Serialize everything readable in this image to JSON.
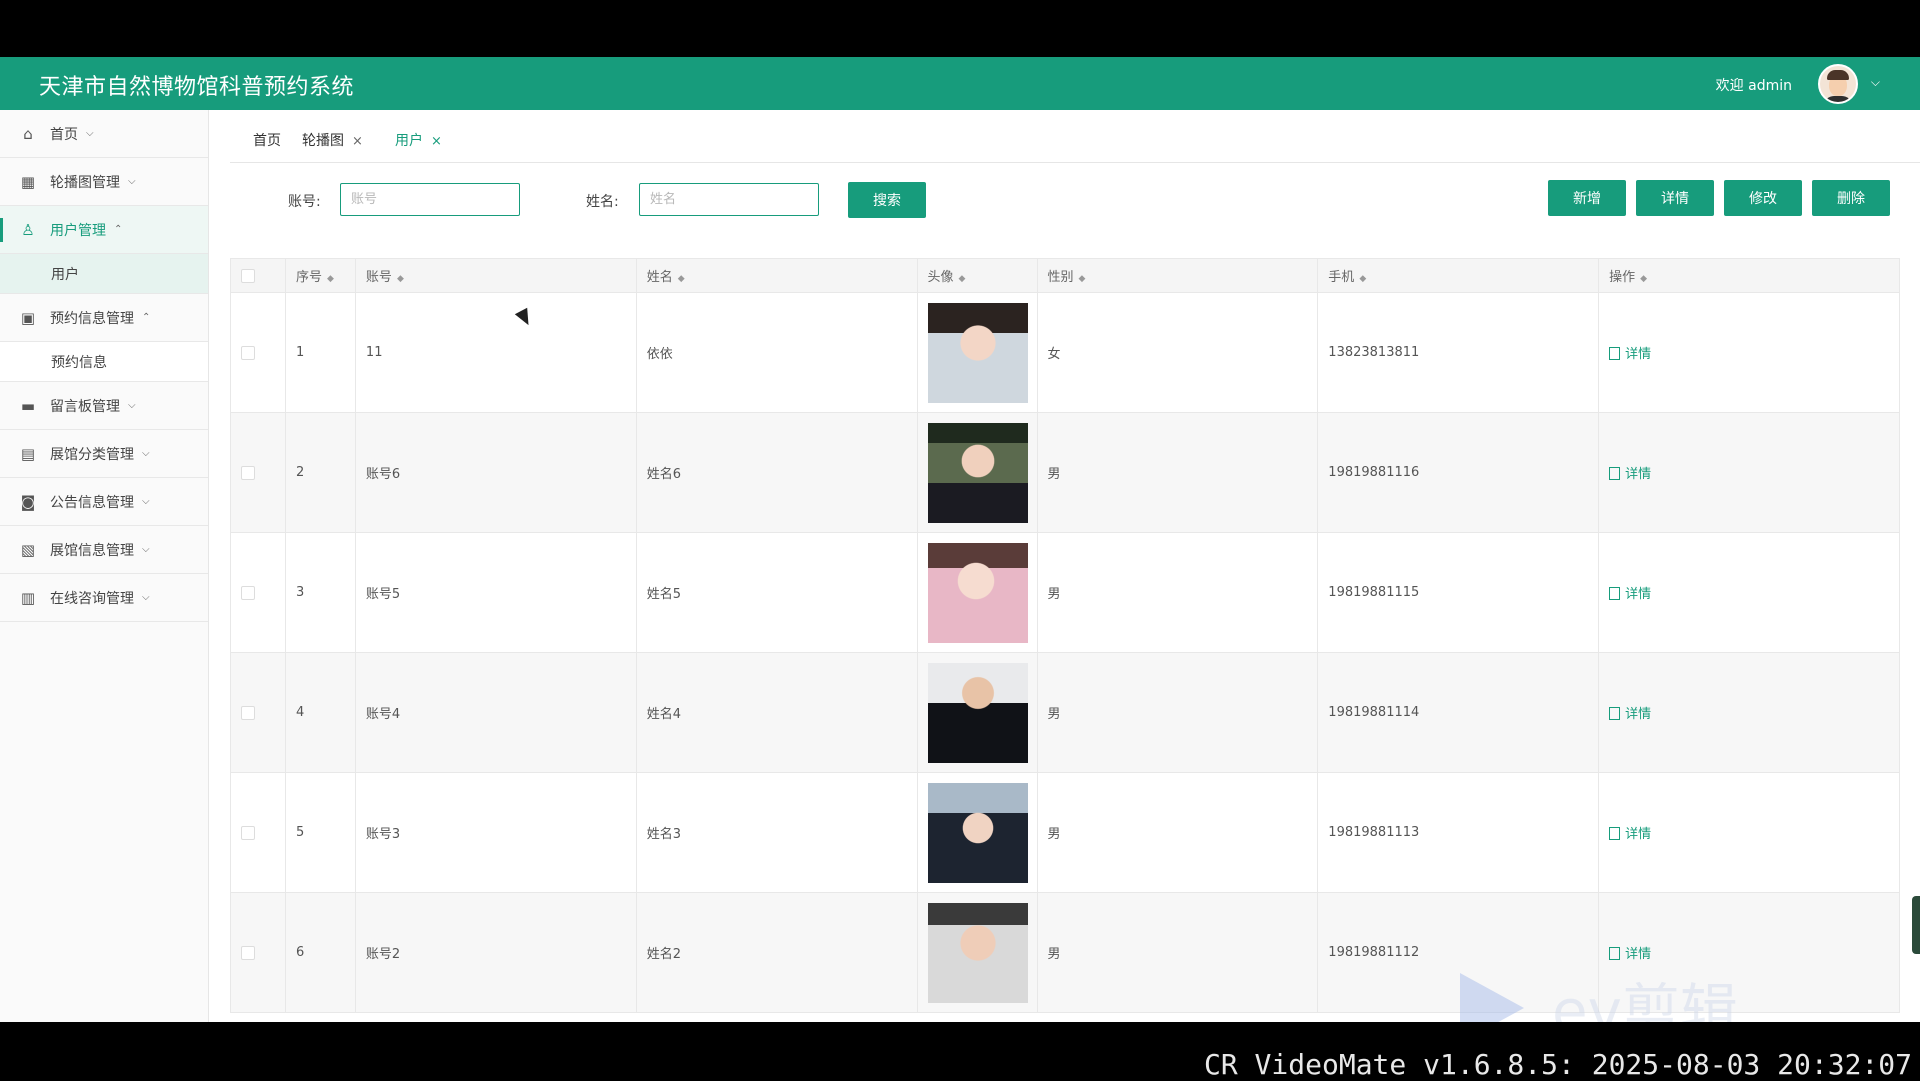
{
  "header": {
    "title": "天津市自然博物馆科普预约系统",
    "welcome": "欢迎 admin",
    "caret": "⌵"
  },
  "sidebar": {
    "items": [
      {
        "label": "首页",
        "icon": "home-icon",
        "chev": "⌵"
      },
      {
        "label": "轮播图管理",
        "icon": "grid-icon",
        "chev": "⌵"
      },
      {
        "label": "用户管理",
        "icon": "user-icon",
        "chev": "⌃",
        "active": true
      },
      {
        "label": "用户",
        "sub": true,
        "active": true
      },
      {
        "label": "预约信息管理",
        "icon": "chip-icon",
        "chev": "⌃"
      },
      {
        "label": "预约信息",
        "sub": true
      },
      {
        "label": "留言板管理",
        "icon": "board-icon",
        "chev": "⌵"
      },
      {
        "label": "展馆分类管理",
        "icon": "store-icon",
        "chev": "⌵"
      },
      {
        "label": "公告信息管理",
        "icon": "notice-icon",
        "chev": "⌵"
      },
      {
        "label": "展馆信息管理",
        "icon": "layers-icon",
        "chev": "⌵"
      },
      {
        "label": "在线咨询管理",
        "icon": "gift-icon",
        "chev": "⌵"
      }
    ]
  },
  "tabs": [
    {
      "label": "首页"
    },
    {
      "label": "轮播图",
      "close": "×"
    },
    {
      "label": "用户",
      "close": "×",
      "current": true
    }
  ],
  "search": {
    "account_label": "账号:",
    "account_placeholder": "账号",
    "name_label": "姓名:",
    "name_placeholder": "姓名",
    "search_button": "搜索"
  },
  "actions": {
    "add": "新增",
    "detail": "详情",
    "edit": "修改",
    "delete": "删除"
  },
  "table": {
    "columns": [
      "序号",
      "账号",
      "姓名",
      "头像",
      "性别",
      "手机",
      "操作"
    ],
    "rows": [
      {
        "no": "1",
        "account": "11",
        "name": "依依",
        "gender": "女",
        "phone": "13823813811",
        "op": "详情"
      },
      {
        "no": "2",
        "account": "账号6",
        "name": "姓名6",
        "gender": "男",
        "phone": "19819881116",
        "op": "详情"
      },
      {
        "no": "3",
        "account": "账号5",
        "name": "姓名5",
        "gender": "男",
        "phone": "19819881115",
        "op": "详情"
      },
      {
        "no": "4",
        "account": "账号4",
        "name": "姓名4",
        "gender": "男",
        "phone": "19819881114",
        "op": "详情"
      },
      {
        "no": "5",
        "account": "账号3",
        "name": "姓名3",
        "gender": "男",
        "phone": "19819881113",
        "op": "详情"
      },
      {
        "no": "6",
        "account": "账号2",
        "name": "姓名2",
        "gender": "男",
        "phone": "19819881112",
        "op": "详情"
      }
    ]
  },
  "overlay": {
    "watermark": "CR VideoMate v1.6.8.5: 2025-08-03 20:32:07",
    "ev_logo": "ev剪辑"
  },
  "colors": {
    "accent": "#179c7c"
  }
}
